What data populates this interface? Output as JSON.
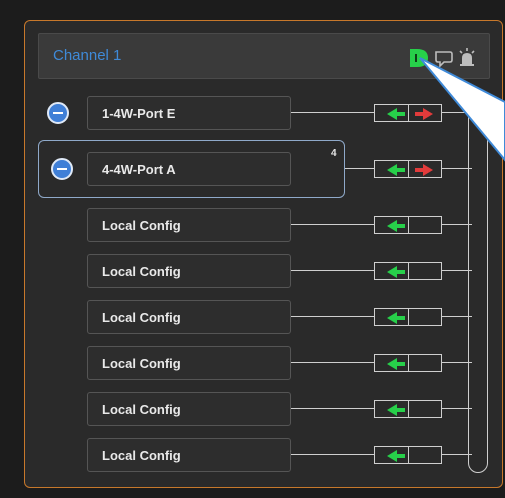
{
  "channel": {
    "title": "Channel 1",
    "header_icons": [
      "green-d-icon",
      "speech-bubble-icon",
      "alarm-icon"
    ]
  },
  "ports": [
    {
      "label": "1-4W-Port E",
      "removable": true,
      "selected": false,
      "arrows": [
        "left-green",
        "right-red"
      ]
    },
    {
      "label": "4-4W-Port A",
      "removable": true,
      "selected": true,
      "badge": "4",
      "arrows": [
        "left-green",
        "right-red"
      ]
    },
    {
      "label": "Local Config",
      "removable": false,
      "selected": false,
      "arrows": [
        "left-green"
      ]
    },
    {
      "label": "Local Config",
      "removable": false,
      "selected": false,
      "arrows": [
        "left-green"
      ]
    },
    {
      "label": "Local Config",
      "removable": false,
      "selected": false,
      "arrows": [
        "left-green"
      ]
    },
    {
      "label": "Local Config",
      "removable": false,
      "selected": false,
      "arrows": [
        "left-green"
      ]
    },
    {
      "label": "Local Config",
      "removable": false,
      "selected": false,
      "arrows": [
        "left-green"
      ]
    },
    {
      "label": "Local Config",
      "removable": false,
      "selected": false,
      "arrows": [
        "left-green"
      ]
    }
  ],
  "colors": {
    "accent_orange": "#c7782b",
    "title_blue": "#3f8ad8",
    "arrow_green": "#27d04a",
    "arrow_red": "#e23b3b",
    "callout_blue": "#3f8ad8"
  }
}
